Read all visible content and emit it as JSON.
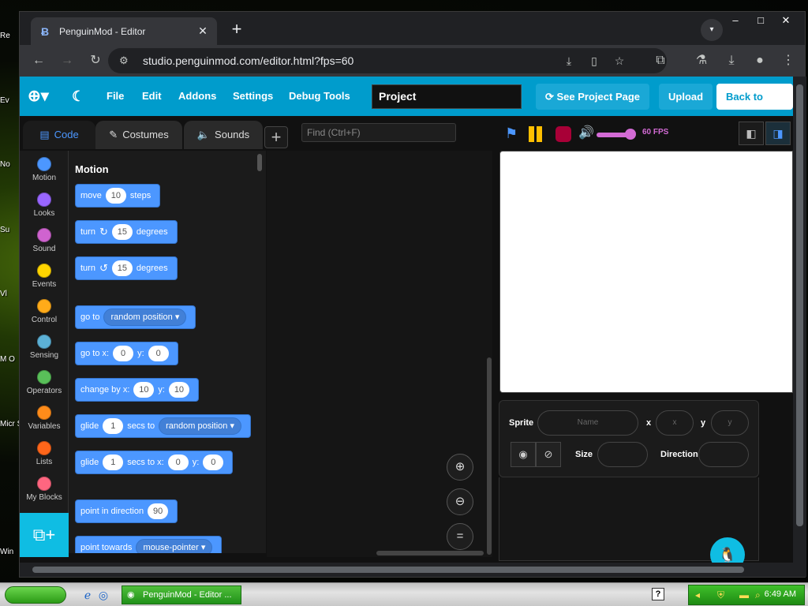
{
  "desktop": {
    "labels": [
      "Re",
      "Ev",
      "No",
      "Su",
      "Vl",
      "M O",
      "Micr Stu",
      "Win"
    ]
  },
  "browser": {
    "tab_title": "PenguinMod - Editor",
    "tab_close": "✕",
    "new_tab": "+",
    "url": "studio.penguinmod.com/editor.html?fps=60",
    "window_controls": {
      "minimize": "–",
      "maximize": "□",
      "close": "✕"
    }
  },
  "app": {
    "menu": {
      "file": "File",
      "edit": "Edit",
      "addons": "Addons",
      "settings": "Settings",
      "debug_tools": "Debug Tools",
      "project_title": "Project",
      "see_project_page": "See Project Page",
      "upload": "Upload",
      "back_to_home": "Back to Home"
    },
    "editor_tabs": {
      "code": "Code",
      "costumes": "Costumes",
      "sounds": "Sounds"
    },
    "find_placeholder": "Find (Ctrl+F)",
    "categories": [
      {
        "label": "Motion",
        "color": "#4c97ff"
      },
      {
        "label": "Looks",
        "color": "#9966ff"
      },
      {
        "label": "Sound",
        "color": "#cf63cf"
      },
      {
        "label": "Events",
        "color": "#ffd500"
      },
      {
        "label": "Control",
        "color": "#ffab19"
      },
      {
        "label": "Sensing",
        "color": "#5cb1d6"
      },
      {
        "label": "Operators",
        "color": "#59c059"
      },
      {
        "label": "Variables",
        "color": "#ff8c1a"
      },
      {
        "label": "Lists",
        "color": "#ff661a"
      },
      {
        "label": "My Blocks",
        "color": "#ff6680"
      }
    ],
    "palette": {
      "section_title": "Motion",
      "blocks": {
        "move": {
          "t1": "move",
          "n1": "10",
          "t2": "steps"
        },
        "turn_right": {
          "t1": "turn",
          "n1": "15",
          "t2": "degrees"
        },
        "turn_left": {
          "t1": "turn",
          "n1": "15",
          "t2": "degrees"
        },
        "go_to": {
          "t1": "go to",
          "d1": "random position"
        },
        "go_to_xy": {
          "t1": "go to x:",
          "n1": "0",
          "t2": "y:",
          "n2": "0"
        },
        "change_by": {
          "t1": "change by x:",
          "n1": "10",
          "t2": "y:",
          "n2": "10"
        },
        "glide_to": {
          "t1": "glide",
          "n1": "1",
          "t2": "secs to",
          "d1": "random position"
        },
        "glide_xy": {
          "t1": "glide",
          "n1": "1",
          "t2": "secs to x:",
          "n2": "0",
          "t3": "y:",
          "n3": "0"
        },
        "point_dir": {
          "t1": "point in direction",
          "n1": "90"
        },
        "point_towards": {
          "t1": "point towards",
          "d1": "mouse-pointer"
        }
      }
    },
    "stage": {
      "fps_label": "60 FPS",
      "volume_level": 0.85
    },
    "sprite_info": {
      "sprite_label": "Sprite",
      "name_placeholder": "Name",
      "x_label": "x",
      "x_placeholder": "x",
      "y_label": "y",
      "y_placeholder": "y",
      "size_label": "Size",
      "direction_label": "Direction"
    }
  },
  "taskbar": {
    "task_title": "PenguinMod - Editor ...",
    "clock": "6:49 AM"
  }
}
